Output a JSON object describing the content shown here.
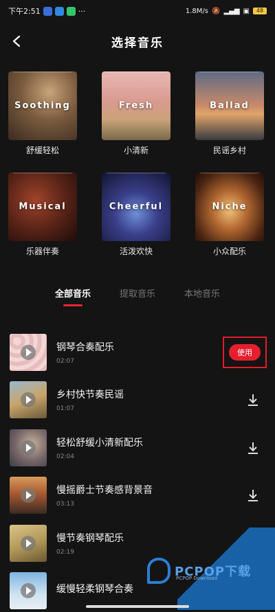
{
  "status_bar": {
    "time": "下午2:51",
    "dots": "···",
    "speed": "1.8M/s",
    "battery": "48"
  },
  "header": {
    "title": "选择音乐"
  },
  "categories": [
    {
      "en": "Soothing",
      "cn": "舒缓轻松"
    },
    {
      "en": "Fresh",
      "cn": "小清新"
    },
    {
      "en": "Ballad",
      "cn": "民谣乡村"
    },
    {
      "en": "Musical",
      "cn": "乐器伴奏"
    },
    {
      "en": "Cheerful",
      "cn": "活泼欢快"
    },
    {
      "en": "Niche",
      "cn": "小众配乐"
    }
  ],
  "tabs": [
    {
      "label": "全部音乐",
      "active": true
    },
    {
      "label": "提取音乐",
      "active": false
    },
    {
      "label": "本地音乐",
      "active": false
    }
  ],
  "tracks": [
    {
      "title": "钢琴合奏配乐",
      "duration": "02:07"
    },
    {
      "title": "乡村快节奏民谣",
      "duration": "01:07"
    },
    {
      "title": "轻松舒缓小清新配乐",
      "duration": "02:04"
    },
    {
      "title": "慢摇爵士节奏感背景音",
      "duration": "03:13"
    },
    {
      "title": "慢节奏钢琴配乐",
      "duration": "02:19"
    },
    {
      "title": "缓慢轻柔钢琴合奏",
      "duration": ""
    }
  ],
  "use_label": "使用",
  "watermark": {
    "brand": "PCPOP下载",
    "sub": "PCPOP Download"
  },
  "colors": {
    "accent": "#e61f2f",
    "background": "#141414"
  }
}
